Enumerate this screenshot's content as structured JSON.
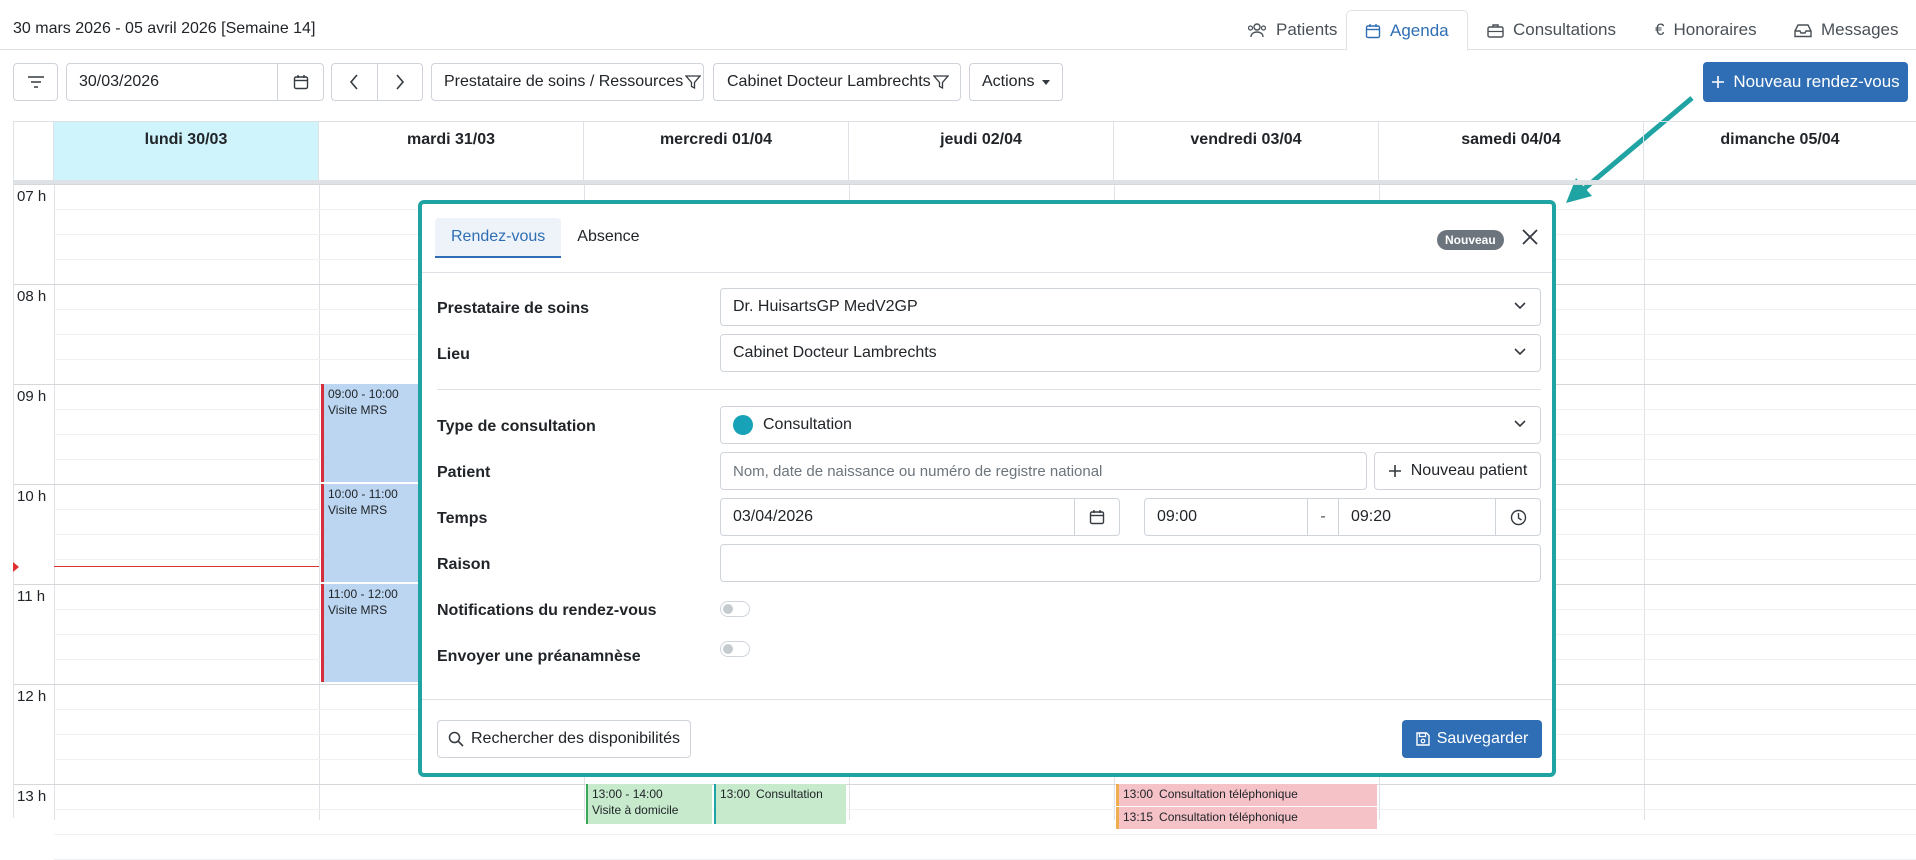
{
  "header": {
    "week_title": "30 mars 2026 - 05 avril 2026 [Semaine 14]",
    "nav": [
      {
        "label": "Patients",
        "icon": "users-icon"
      },
      {
        "label": "Agenda",
        "icon": "calendar-icon",
        "active": true
      },
      {
        "label": "Consultations",
        "icon": "briefcase-icon"
      },
      {
        "label": "Honoraires",
        "icon": "euro-icon"
      },
      {
        "label": "Messages",
        "icon": "inbox-icon"
      }
    ]
  },
  "toolbar": {
    "date_value": "30/03/2026",
    "provider_filter": "Prestataire de soins / Ressources",
    "location_filter": "Cabinet Docteur Lambrechts",
    "actions_label": "Actions",
    "new_appointment": "Nouveau rendez-vous"
  },
  "calendar": {
    "days": [
      "lundi 30/03",
      "mardi 31/03",
      "mercredi 01/04",
      "jeudi 02/04",
      "vendredi 03/04",
      "samedi 04/04",
      "dimanche 05/04"
    ],
    "today_index": 0,
    "hours": [
      "07 h",
      "08 h",
      "09 h",
      "10 h",
      "11 h",
      "12 h",
      "13 h"
    ],
    "events": [
      {
        "day": 1,
        "time": "09:00 - 10:00",
        "title": "Visite MRS",
        "color": "#bcd6f2",
        "border": "#d62f3c"
      },
      {
        "day": 1,
        "time": "10:00 - 11:00",
        "title": "Visite MRS",
        "color": "#bcd6f2",
        "border": "#d62f3c"
      },
      {
        "day": 1,
        "time": "11:00 - 12:00",
        "title": "Visite MRS",
        "color": "#bcd6f2",
        "border": "#d62f3c"
      },
      {
        "day": 2,
        "time": "13:00 - 14:00",
        "title": "Visite à domicile",
        "color": "#c7e9cc",
        "border": "#3aa657"
      },
      {
        "day": 2,
        "time": "13:00",
        "title": "Consultation",
        "color": "#c7e9cc",
        "border": "#1fa3a3"
      },
      {
        "day": 4,
        "time": "13:00",
        "title": "Consultation téléphonique",
        "color": "#f4c2c7",
        "border": "#f0ad4e"
      },
      {
        "day": 4,
        "time": "13:15",
        "title": "Consultation téléphonique",
        "color": "#f4c2c7",
        "border": "#f0ad4e"
      }
    ]
  },
  "modal": {
    "tabs": [
      "Rendez-vous",
      "Absence"
    ],
    "active_tab": 0,
    "badge": "Nouveau",
    "labels": {
      "provider": "Prestataire de soins",
      "location": "Lieu",
      "type": "Type de consultation",
      "patient": "Patient",
      "time": "Temps",
      "reason": "Raison",
      "notifications": "Notifications du rendez-vous",
      "preanamnesis": "Envoyer une préanamnèse"
    },
    "values": {
      "provider": "Dr. HuisartsGP MedV2GP",
      "location": "Cabinet Docteur Lambrechts",
      "type": "Consultation",
      "type_color": "#17a2b8",
      "patient_placeholder": "Nom, date de naissance ou numéro de registre national",
      "new_patient": "Nouveau patient",
      "date": "03/04/2026",
      "start": "09:00",
      "dash": "-",
      "end": "09:20",
      "reason": ""
    },
    "toggles": {
      "notifications": false,
      "preanamnesis": false
    },
    "search_availability": "Rechercher des disponibilités",
    "save": "Sauvegarder"
  },
  "colors": {
    "accent": "#2f6eb4",
    "highlight": "#1fa3a3",
    "today": "#cff4fc",
    "now_line": "#e03131"
  }
}
